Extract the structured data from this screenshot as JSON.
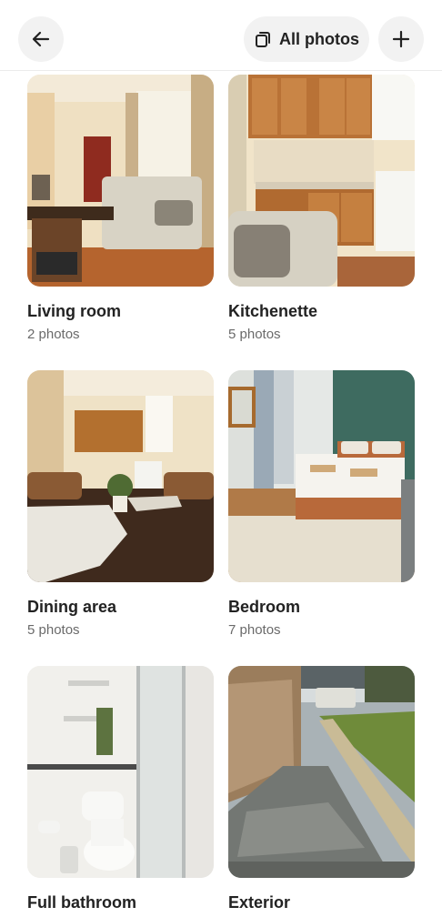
{
  "header": {
    "all_photos_label": "All photos"
  },
  "rooms": [
    {
      "title": "Living room",
      "count": "2 photos"
    },
    {
      "title": "Kitchenette",
      "count": "5 photos"
    },
    {
      "title": "Dining area",
      "count": "5 photos"
    },
    {
      "title": "Bedroom",
      "count": "7 photos"
    },
    {
      "title": "Full bathroom",
      "count": ""
    },
    {
      "title": "Exterior",
      "count": ""
    }
  ],
  "icons": {
    "back": "arrow-left-icon",
    "gallery": "photo-stack-icon",
    "add": "plus-icon"
  }
}
